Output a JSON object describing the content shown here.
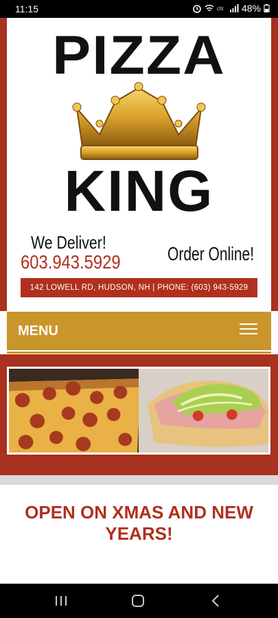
{
  "status_bar": {
    "time": "11:15",
    "battery": "48%",
    "icons": [
      "alarm-icon",
      "wifi-icon",
      "volte-icon",
      "signal-icon",
      "battery-icon"
    ]
  },
  "logo": {
    "top_word": "PIZZA",
    "bottom_word": "KING",
    "icon": "crown-icon"
  },
  "contact": {
    "deliver_label": "We Deliver!",
    "phone": "603.943.5929",
    "order_label": "Order Online!",
    "address_line": "142 LOWELL RD, HUDSON, NH  |  PHONE: (603) 943-5929"
  },
  "menu_bar": {
    "label": "MENU",
    "icon": "hamburger-menu-icon"
  },
  "hero": {
    "image": "pizza-and-sub-photo"
  },
  "announcement": {
    "text": "OPEN ON XMAS AND NEW YEARS!"
  },
  "nav_bar": {
    "buttons": [
      "recent-apps-icon",
      "home-icon",
      "back-icon"
    ]
  },
  "colors": {
    "brand_red": "#b0301d",
    "gold": "#c9962c",
    "frame_red": "#a8321f"
  }
}
